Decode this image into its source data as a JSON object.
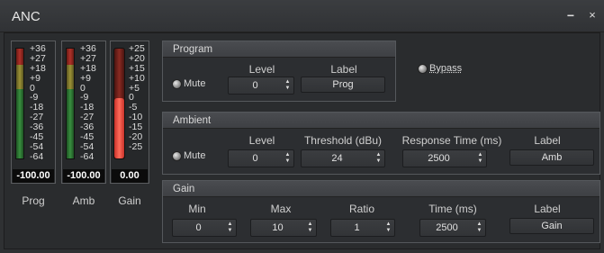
{
  "window": {
    "title": "ANC",
    "minimize_label": "−",
    "close_label": "×"
  },
  "meters": [
    {
      "name": "Prog",
      "readout": "-100.00",
      "scale": [
        "+36",
        "+27",
        "+18",
        "+9",
        "0",
        "-9",
        "-18",
        "-27",
        "-36",
        "-45",
        "-54",
        "-64"
      ]
    },
    {
      "name": "Amb",
      "readout": "-100.00",
      "scale": [
        "+36",
        "+27",
        "+18",
        "+9",
        "0",
        "-9",
        "-18",
        "-27",
        "-36",
        "-45",
        "-54",
        "-64"
      ]
    },
    {
      "name": "Gain",
      "readout": "0.00",
      "level_fraction": 0.55,
      "scale": [
        "+25",
        "+20",
        "+15",
        "+10",
        "+5",
        "0",
        "-5",
        "-10",
        "-15",
        "-20",
        "-25"
      ]
    }
  ],
  "program": {
    "title": "Program",
    "mute_label": "Mute",
    "level_label": "Level",
    "level_value": "0",
    "label_label": "Label",
    "label_value": "Prog"
  },
  "bypass_label": "Bypass",
  "ambient": {
    "title": "Ambient",
    "mute_label": "Mute",
    "level_label": "Level",
    "level_value": "0",
    "threshold_label": "Threshold (dBu)",
    "threshold_value": "24",
    "response_label": "Response Time (ms)",
    "response_value": "2500",
    "label_label": "Label",
    "label_value": "Amb"
  },
  "gain": {
    "title": "Gain",
    "min_label": "Min",
    "min_value": "0",
    "max_label": "Max",
    "max_value": "10",
    "ratio_label": "Ratio",
    "ratio_value": "1",
    "time_label": "Time (ms)",
    "time_value": "2500",
    "label_label": "Label",
    "label_value": "Gain"
  },
  "colors": {
    "meter_green": "#3a8f3f",
    "meter_yellow": "#9c9236",
    "meter_red": "#b0322a",
    "gain_fill": "#ff6a5a"
  }
}
